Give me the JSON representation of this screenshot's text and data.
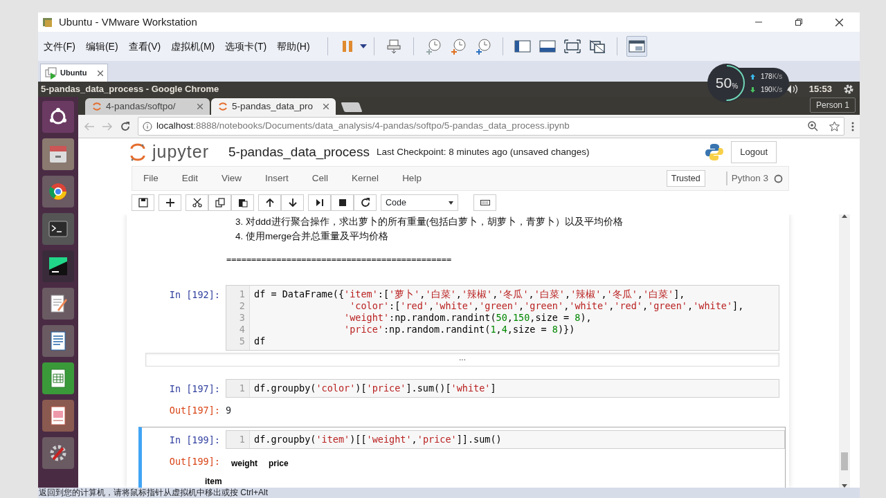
{
  "window": {
    "title": "Ubuntu - VMware Workstation"
  },
  "menu": [
    "文件(F)",
    "编辑(E)",
    "查看(V)",
    "虚拟机(M)",
    "选项卡(T)",
    "帮助(H)"
  ],
  "vm_tabs": [
    {
      "label": "Ubuntu",
      "selected": true
    }
  ],
  "top_bar": {
    "title": "5-pandas_data_process - Google Chrome",
    "time": "15:53"
  },
  "network_widget": {
    "percent": "50",
    "unit": "%",
    "upload": "178",
    "upload_unit": "K/s",
    "download": "190",
    "download_unit": "K/s"
  },
  "browser": {
    "tabs": [
      {
        "label": "4-pandas/softpo/",
        "selected": false
      },
      {
        "label": "5-pandas_data_pro",
        "selected": true
      }
    ],
    "profile": "Person 1",
    "url_host": "localhost",
    "url_rest": ":8888/notebooks/Documents/data_analysis/4-pandas/softpo/5-pandas_data_process.ipynb"
  },
  "jupyter": {
    "logo_text": "jupyter",
    "notebook_name": "5-pandas_data_process",
    "checkpoint": "Last Checkpoint: 8 minutes ago (unsaved changes)",
    "logout": "Logout",
    "menu": [
      "File",
      "Edit",
      "View",
      "Insert",
      "Cell",
      "Kernel",
      "Help"
    ],
    "trusted": "Trusted",
    "kernel": "Python 3",
    "kernel_busy": false,
    "cell_type": "Code"
  },
  "cells": [
    {
      "kind": "markdown",
      "lines": [
        "3. 对ddd进行聚合操作，求出萝卜的所有重量(包括白萝卜，胡萝卜，青萝卜）以及平均价格",
        "4. 使用merge合并总重量及平均价格"
      ],
      "rule": "============================================="
    },
    {
      "kind": "code",
      "selected": false,
      "prompt": "In [192]:",
      "lines": [
        {
          "no": "1",
          "code": "df = DataFrame({'item':['萝卜','白菜','辣椒','冬瓜','白菜','辣椒','冬瓜','白菜'],"
        },
        {
          "no": "2",
          "code": "                 'color':['red','white','green','green','white','red','green','white'],"
        },
        {
          "no": "3",
          "code": "                'weight':np.random.randint(50,150,size = 8),"
        },
        {
          "no": "4",
          "code": "                'price':np.random.randint(1,4,size = 8)})"
        },
        {
          "no": "5",
          "code": "df"
        }
      ],
      "collapsed_marker": "..."
    },
    {
      "kind": "code",
      "selected": false,
      "prompt": "In [197]:",
      "lines": [
        {
          "no": "1",
          "code": "df.groupby('color')['price'].sum()['white']"
        }
      ],
      "out_prompt": "Out[197]:",
      "output": "9"
    },
    {
      "kind": "code",
      "selected": true,
      "prompt": "In [199]:",
      "lines": [
        {
          "no": "1",
          "code": "df.groupby('item')[['weight','price']].sum()"
        }
      ],
      "out_prompt": "Out[199]:",
      "table": {
        "columns": [
          "weight",
          "price"
        ],
        "index_name": "item"
      }
    }
  ],
  "status_bar": {
    "text": "返回到您的计算机，请将鼠标指针从虚拟机中移出或按 Ctrl+Alt"
  }
}
